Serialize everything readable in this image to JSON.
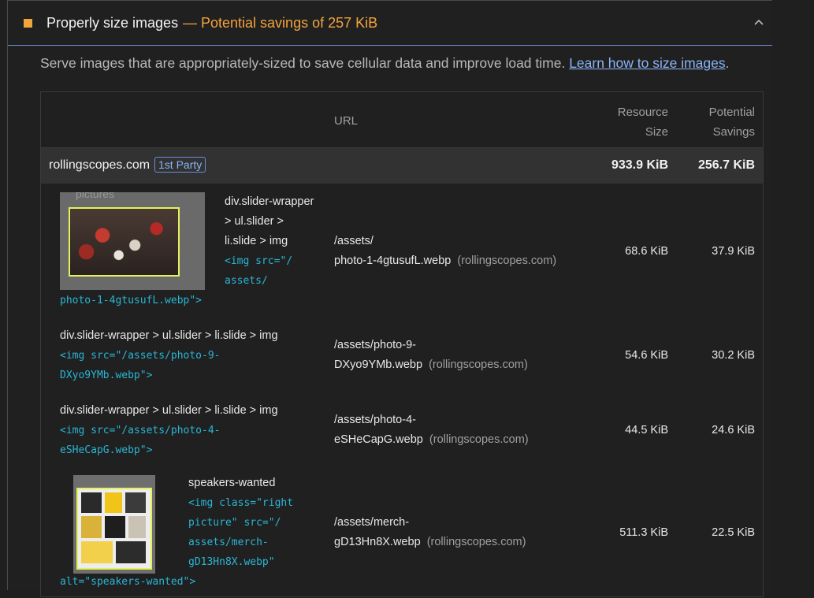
{
  "audit": {
    "title": "Properly size images",
    "savings": "— Potential savings of 257 KiB",
    "status_color": "#f3a33b"
  },
  "description": {
    "text": "Serve images that are appropriately-sized to save cellular data and improve load time. ",
    "link": "Learn how to size images",
    "suffix": "."
  },
  "table": {
    "headers": {
      "url": "URL",
      "size_line1": "Resource",
      "size_line2": "Size",
      "savings_line1": "Potential",
      "savings_line2": "Savings"
    },
    "party": {
      "name": "rollingscopes.com",
      "badge": "1st Party",
      "size": "933.9 KiB",
      "savings": "256.7 KiB"
    },
    "rows": [
      {
        "node_lines": [
          "div.slider-wrapper",
          "> ul.slider >",
          "li.slide > img"
        ],
        "snippet_lines": [
          "<img src=\"/",
          "assets/",
          "photo-1-4gtusufL.webp\">"
        ],
        "thumb_caption": "pictures",
        "url_path": "/assets/",
        "url_file": "photo-1-4gtusufL.webp",
        "origin": "(rollingscopes.com)",
        "size": "68.6 KiB",
        "savings": "37.9 KiB"
      },
      {
        "node_lines": [
          "div.slider-wrapper > ul.slider > li.slide > img"
        ],
        "snippet_lines": [
          "<img src=\"/assets/photo-9-",
          "DXyo9YMb.webp\">"
        ],
        "url_path": "/assets/photo-9-",
        "url_file": "DXyo9YMb.webp",
        "origin": "(rollingscopes.com)",
        "size": "54.6 KiB",
        "savings": "30.2 KiB"
      },
      {
        "node_lines": [
          "div.slider-wrapper > ul.slider > li.slide > img"
        ],
        "snippet_lines": [
          "<img src=\"/assets/photo-4-",
          "eSHeCapG.webp\">"
        ],
        "url_path": "/assets/photo-4-",
        "url_file": "eSHeCapG.webp",
        "origin": "(rollingscopes.com)",
        "size": "44.5 KiB",
        "savings": "24.6 KiB"
      },
      {
        "node_lines": [
          "speakers-wanted"
        ],
        "snippet_lines": [
          "<img class=\"right",
          "picture\" src=\"/",
          "assets/merch-",
          "gD13Hn8X.webp\"",
          "alt=\"speakers-wanted\">"
        ],
        "url_path": "/assets/merch-",
        "url_file": "gD13Hn8X.webp",
        "origin": "(rollingscopes.com)",
        "size": "511.3 KiB",
        "savings": "22.5 KiB"
      }
    ]
  }
}
